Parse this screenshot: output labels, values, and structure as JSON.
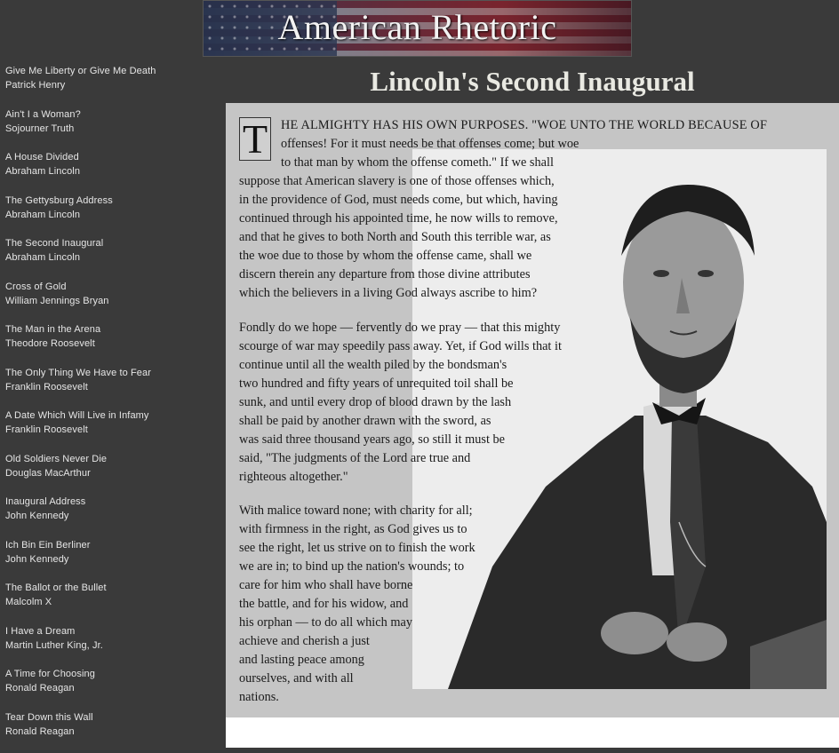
{
  "banner": {
    "title": "American Rhetoric"
  },
  "page_title": "Lincoln's Second Inaugural",
  "sidebar": {
    "items": [
      {
        "title": "Give Me Liberty or Give Me Death",
        "author": "Patrick Henry"
      },
      {
        "title": "Ain't I a Woman?",
        "author": "Sojourner Truth"
      },
      {
        "title": "A House Divided",
        "author": "Abraham Lincoln"
      },
      {
        "title": "The Gettysburg Address",
        "author": "Abraham Lincoln"
      },
      {
        "title": "The Second Inaugural",
        "author": "Abraham Lincoln"
      },
      {
        "title": "Cross of Gold",
        "author": "William Jennings Bryan"
      },
      {
        "title": "The Man in the Arena",
        "author": "Theodore Roosevelt"
      },
      {
        "title": "The Only Thing We Have to Fear",
        "author": "Franklin Roosevelt"
      },
      {
        "title": "A Date Which Will Live in Infamy",
        "author": "Franklin Roosevelt"
      },
      {
        "title": "Old Soldiers Never Die",
        "author": "Douglas MacArthur"
      },
      {
        "title": "Inaugural Address",
        "author": "John Kennedy"
      },
      {
        "title": "Ich Bin Ein Berliner",
        "author": "John Kennedy"
      },
      {
        "title": "The Ballot or the Bullet",
        "author": "Malcolm X"
      },
      {
        "title": "I Have a Dream",
        "author": "Martin Luther King, Jr."
      },
      {
        "title": "A Time for Choosing",
        "author": "Ronald Reagan"
      },
      {
        "title": "Tear Down this Wall",
        "author": "Ronald Reagan"
      }
    ]
  },
  "speech": {
    "dropcap": "T",
    "paragraph1": [
      "HE ALMIGHTY HAS HIS OWN PURPOSES. \"WOE UNTO THE WORLD BECAUSE OF",
      "offenses! For it must needs be that offenses come; but woe",
      "to that man by whom the offense cometh.\" If we shall",
      "suppose that American slavery is one of those offenses which,",
      "in the providence of God, must needs come, but which, having",
      "continued through his appointed time, he now wills to remove,",
      "and that he gives to both North and South this terrible war, as",
      "the woe due to those by whom the offense came, shall we",
      "discern therein any departure from those divine attributes",
      "which the believers in a living God always ascribe to him?"
    ],
    "paragraph2": [
      "Fondly do we hope — fervently do we pray — that this mighty",
      "scourge of war may speedily pass away. Yet, if God wills that it",
      "continue until all the wealth piled by the bondsman's",
      "two hundred and fifty years of unrequited toil shall be",
      "sunk, and until every drop of blood drawn by the lash",
      "shall be paid by another drawn with the sword, as",
      "was said three thousand years ago, so still it must be",
      "said, \"The judgments of the Lord are true and",
      "righteous altogether.\""
    ],
    "paragraph3": [
      "With malice toward none; with charity for all;",
      "with firmness in the right, as God gives us to",
      "see the right, let us strive on to finish the work",
      "we are in; to bind up the nation's wounds; to",
      "care for him who shall have borne",
      "the battle, and for his widow, and",
      "his orphan — to do all which may",
      "achieve and cherish a just",
      "and lasting peace among",
      "ourselves, and with all",
      "nations."
    ]
  }
}
